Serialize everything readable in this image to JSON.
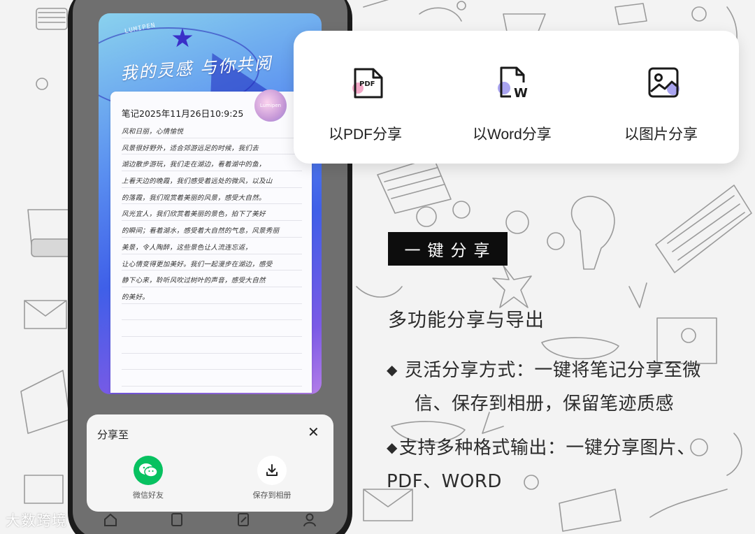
{
  "note": {
    "cover_title": "我的灵感 与你共阅",
    "brand_small": "LUMIPEN",
    "badge_text": "Lumipen",
    "date": "笔记2025年11月26日10:9:25",
    "lines": [
      "风和日丽，心情愉悦",
      "    风景很好野外，适合郊游远足的时候，我们去",
      "湖边散步游玩，我们走在湖边，看着湖中的鱼，",
      "上看天边的晚霞，我们感受着远处的微风，以及山",
      "的落霞，我们观赏着美丽的风景，感受大自然。",
      "    风光宜人，我们欣赏着美丽的景色，拍下了美好",
      "的瞬间；看着湖水，感受着大自然的气息，风景秀丽",
      "美景，令人陶醉，这些景色让人流连忘返，",
      "让心情变得更加美好。我们一起漫步在湖边，感受",
      "静下心来，聆听风吹过树叶的声音，感受大自然",
      "的美好。",
      "",
      "",
      "",
      "",
      ""
    ]
  },
  "share_sheet": {
    "title": "分享至",
    "close_glyph": "✕",
    "options": [
      {
        "label": "微信好友",
        "icon": "wechat-icon"
      },
      {
        "label": "保存到相册",
        "icon": "download-icon"
      }
    ]
  },
  "export_popup": {
    "items": [
      {
        "label": "以PDF分享",
        "icon": "pdf-file-icon",
        "icon_text": "PDF"
      },
      {
        "label": "以Word分享",
        "icon": "word-file-icon",
        "icon_text": "W"
      },
      {
        "label": "以图片分享",
        "icon": "image-icon"
      }
    ]
  },
  "feature": {
    "tag": "一键分享",
    "subheading": "多功能分享与导出",
    "bullets": [
      {
        "line1": "灵活分享方式：一键将笔记分享至微",
        "line2": "信、保存到相册，保留笔迹质感"
      },
      {
        "line1": "支持多种格式输出：一键分享图片、",
        "line2": "PDF、WORD"
      }
    ],
    "bullet_glyph": "◆"
  },
  "watermark": "大数跨境",
  "colors": {
    "wechat_green": "#07c160",
    "tag_bg": "#0d0d0d",
    "accent_pink": "#f3a9c8",
    "accent_purple": "#a9a4f0"
  }
}
